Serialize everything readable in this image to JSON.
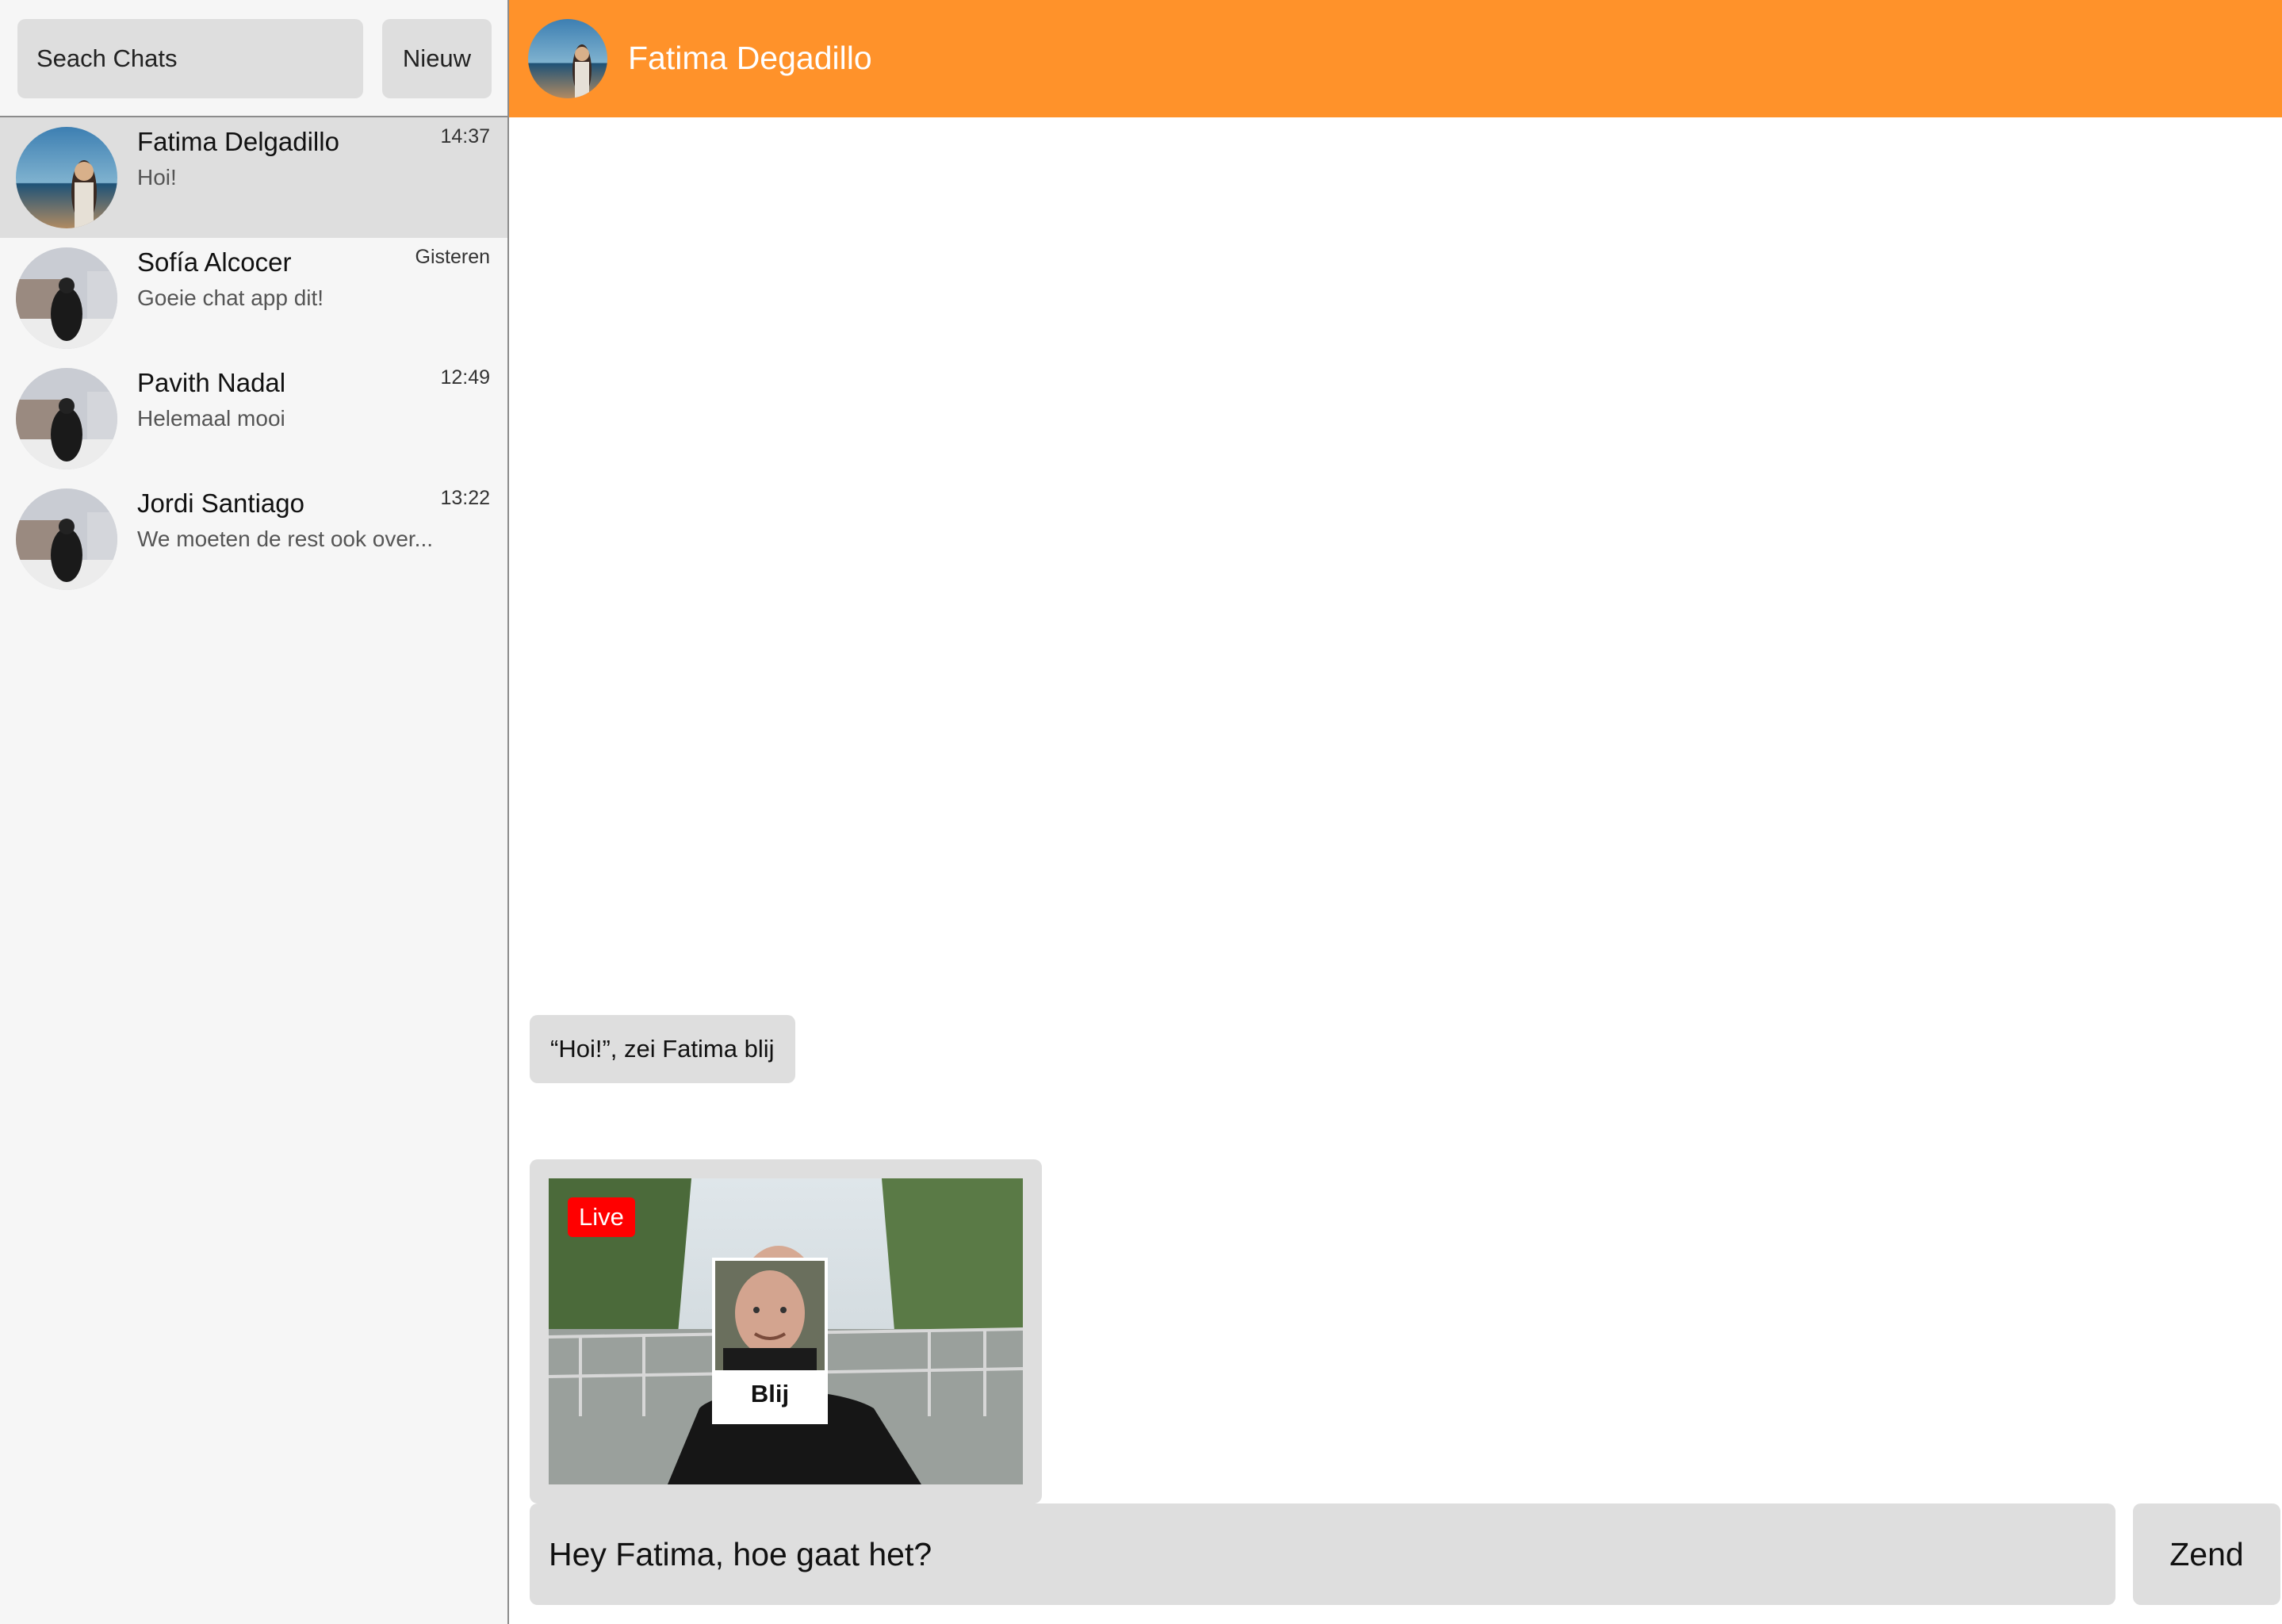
{
  "colors": {
    "accent": "#ff922a",
    "sidebar_bg": "#f6f6f6",
    "selected_bg": "#dedede",
    "bubble_bg": "#dedede",
    "live": "#ff0000"
  },
  "sidebar": {
    "search_placeholder": "Seach Chats",
    "new_button": "Nieuw",
    "chats": [
      {
        "name": "Fatima Delgadillo",
        "preview": "Hoi!",
        "time": "14:37",
        "selected": true,
        "avatar_icon": "avatar-photo-icon"
      },
      {
        "name": "Sofía Alcocer",
        "preview": "Goeie chat app dit!",
        "time": "Gisteren",
        "selected": false,
        "avatar_icon": "avatar-photo-icon"
      },
      {
        "name": "Pavith Nadal",
        "preview": "Helemaal mooi",
        "time": "12:49",
        "selected": false,
        "avatar_icon": "avatar-photo-icon"
      },
      {
        "name": "Jordi Santiago",
        "preview": "We moeten de rest ook over...",
        "time": "13:22",
        "selected": false,
        "avatar_icon": "avatar-photo-icon"
      }
    ]
  },
  "conversation": {
    "title": "Fatima Degadillo",
    "messages": [
      {
        "type": "text",
        "text": "“Hoi!”, zei Fatima blij"
      },
      {
        "type": "video",
        "badge": "Live",
        "emotion_label": "Blij"
      }
    ],
    "composer_value": "Hey Fatima, hoe gaat het?",
    "send_button": "Zend"
  }
}
